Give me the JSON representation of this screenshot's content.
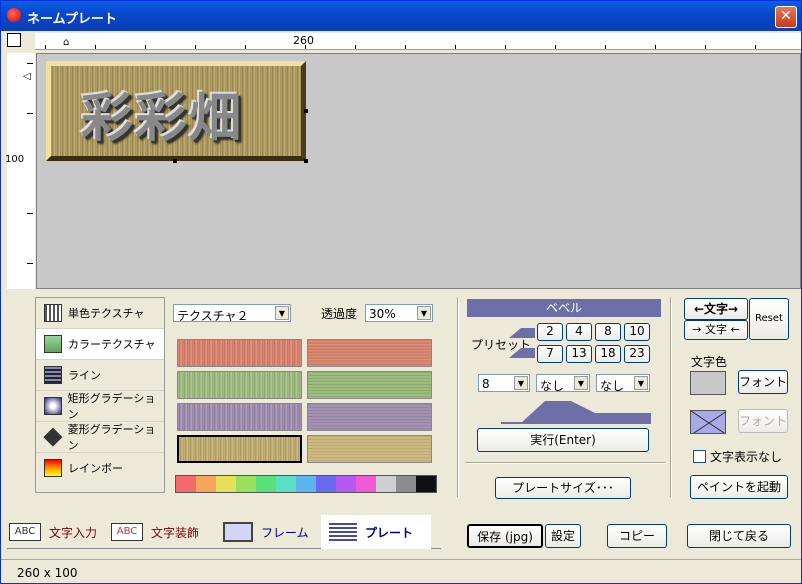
{
  "window": {
    "title": "ネームプレート",
    "close_label": "✕"
  },
  "ruler": {
    "h_label": "260",
    "v_label": "100"
  },
  "plate": {
    "text": "彩彩畑"
  },
  "texture_modes": [
    {
      "label": "単色テクスチャ"
    },
    {
      "label": "カラーテクスチャ"
    },
    {
      "label": "ライン"
    },
    {
      "label": "矩形グラデーション"
    },
    {
      "label": "菱形グラデーション"
    },
    {
      "label": "レインボー"
    }
  ],
  "texture_select": {
    "value": "テクスチャ２"
  },
  "opacity": {
    "label": "透過度",
    "value": "30%"
  },
  "palette_colors": [
    "#f26a6a",
    "#f6a45a",
    "#e6e05a",
    "#9be05a",
    "#5ae07a",
    "#5ae0c4",
    "#5ab4f0",
    "#6a6af0",
    "#b45af0",
    "#f05ad6",
    "#cfcfcf",
    "#8c8c8c",
    "#111111"
  ],
  "bevel": {
    "header": "ベベル",
    "preset_label": "プリセット",
    "presets_row1": [
      "2",
      "4",
      "8",
      "10"
    ],
    "presets_row2": [
      "7",
      "13",
      "18",
      "23"
    ],
    "select1": "8",
    "select2": "なし",
    "select3": "なし",
    "execute": "実行(Enter)"
  },
  "plate_size_button": "プレートサイズ･･･",
  "text_controls": {
    "left_text": "←文字→",
    "right_text": "→ 文字 ←",
    "reset": "Reset",
    "text_color_label": "文字色",
    "font_button": "フォント",
    "font_button_disabled": "フォント",
    "hide_text_label": "文字表示なし",
    "paint_button": "ペイントを起動"
  },
  "tabs": [
    {
      "icon_text": "ABC",
      "label": "文字入力"
    },
    {
      "icon_text": "ABC",
      "label": "文字装飾"
    },
    {
      "label": "フレーム"
    },
    {
      "label": "プレート"
    }
  ],
  "bottom_buttons": {
    "save": "保存 (jpg)",
    "settings": "設定",
    "copy": "コピー",
    "close": "閉じて戻る"
  },
  "status": {
    "size": "260 x 100"
  }
}
